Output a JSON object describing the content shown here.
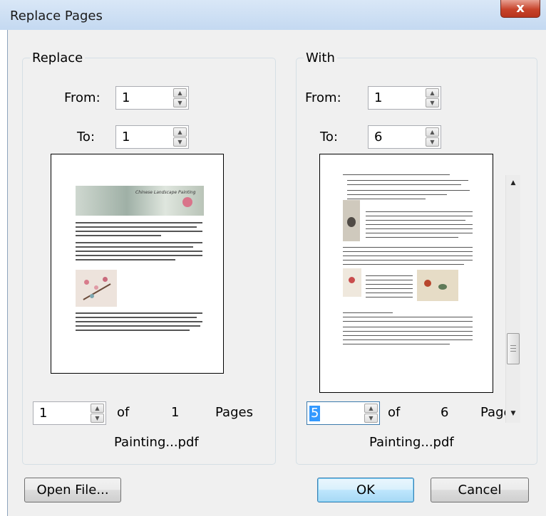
{
  "window": {
    "title": "Replace Pages",
    "close_glyph": "x"
  },
  "replace": {
    "group_label": "Replace",
    "from_label": "From:",
    "from_value": "1",
    "to_label": "To:",
    "to_value": "1",
    "preview": {
      "banner_title": "Chinese Landscape Painting"
    },
    "page_value": "1",
    "of_label": "of",
    "total_pages": "1",
    "pages_label": "Pages",
    "file_name": "Painting...pdf"
  },
  "with": {
    "group_label": "With",
    "from_label": "From:",
    "from_value": "1",
    "to_label": "To:",
    "to_value": "6",
    "page_value": "5",
    "of_label": "of",
    "total_pages": "6",
    "pages_label": "Pages",
    "file_name": "Painting...pdf"
  },
  "buttons": {
    "open_file": "Open File...",
    "ok": "OK",
    "cancel": "Cancel"
  },
  "icons": {
    "spin_up": "▲",
    "spin_down": "▼",
    "scroll_up": "▲",
    "scroll_down": "▼"
  },
  "colors": {
    "titlebar": "#c4d9f1",
    "close_button": "#c7432a",
    "dialog_bg": "#f0f0f0",
    "selection": "#3399ff",
    "default_button": "#bee6fd"
  }
}
